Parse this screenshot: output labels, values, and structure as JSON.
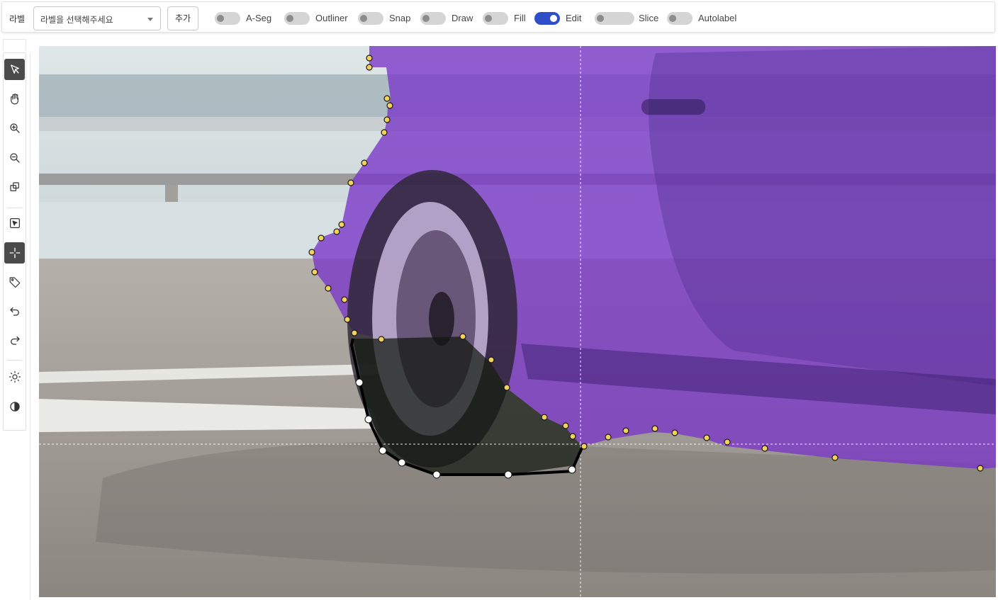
{
  "toolbar": {
    "label_caption": "라벨",
    "select_placeholder": "라벨을 선택해주세요",
    "add_button": "추가",
    "toggles": [
      {
        "label": "A-Seg",
        "on": false
      },
      {
        "label": "Outliner",
        "on": false
      },
      {
        "label": "Snap",
        "on": false
      },
      {
        "label": "Draw",
        "on": false
      },
      {
        "label": "Fill",
        "on": false
      },
      {
        "label": "Edit",
        "on": true
      },
      {
        "label": "Slice",
        "on": false
      },
      {
        "label": "Autolabel",
        "on": false
      }
    ]
  },
  "tools": [
    {
      "name": "select-pointer-icon",
      "active": true
    },
    {
      "name": "hand-pan-icon",
      "active": false
    },
    {
      "name": "zoom-in-icon",
      "active": false
    },
    {
      "name": "zoom-out-icon",
      "active": false
    },
    {
      "name": "copy-icon",
      "active": false
    },
    {
      "name": "box-select-icon",
      "active": false
    },
    {
      "name": "crosshair-icon",
      "active": true
    },
    {
      "name": "tag-icon",
      "active": false
    },
    {
      "name": "undo-icon",
      "active": false
    },
    {
      "name": "redo-icon",
      "active": false
    },
    {
      "name": "brightness-icon",
      "active": false
    },
    {
      "name": "contrast-icon",
      "active": false
    }
  ],
  "colors": {
    "accent": "#2f4fc9",
    "mask": "#7a36c8",
    "vertex": "#f2d15c",
    "active_tool": "#4a4a4a"
  }
}
